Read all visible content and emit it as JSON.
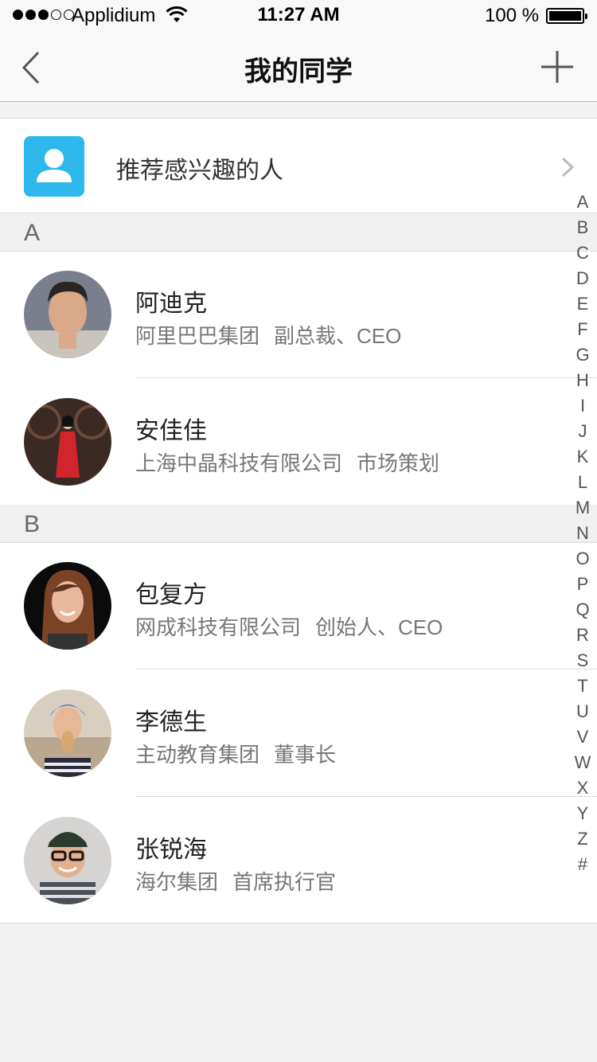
{
  "status_bar": {
    "carrier": "Applidium",
    "time": "11:27 AM",
    "battery": "100 %"
  },
  "nav": {
    "title": "我的同学"
  },
  "recommend": {
    "label": "推荐感兴趣的人"
  },
  "sections": [
    {
      "letter": "A",
      "contacts": [
        {
          "name": "阿迪克",
          "company": "阿里巴巴集团",
          "title": "副总裁、CEO"
        },
        {
          "name": "安佳佳",
          "company": "上海中晶科技有限公司",
          "title": "市场策划"
        }
      ]
    },
    {
      "letter": "B",
      "contacts": [
        {
          "name": "包复方",
          "company": "网成科技有限公司",
          "title": "创始人、CEO"
        },
        {
          "name": "李德生",
          "company": "主动教育集团",
          "title": "董事长"
        },
        {
          "name": "张锐海",
          "company": "海尔集团",
          "title": "首席执行官"
        }
      ]
    }
  ],
  "index_letters": [
    "A",
    "B",
    "C",
    "D",
    "E",
    "F",
    "G",
    "H",
    "I",
    "J",
    "K",
    "L",
    "M",
    "N",
    "O",
    "P",
    "Q",
    "R",
    "S",
    "T",
    "U",
    "V",
    "W",
    "X",
    "Y",
    "Z",
    "#"
  ],
  "colors": {
    "accent": "#2fb8ec",
    "background": "#f2f2f2"
  }
}
